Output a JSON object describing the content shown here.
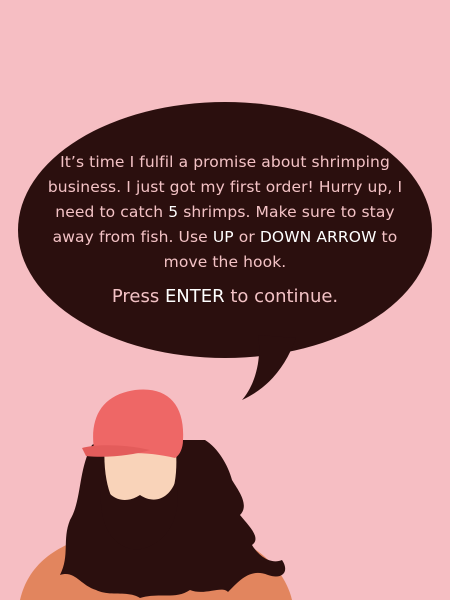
{
  "colors": {
    "background": "#f6bec3",
    "bubble": "#2b0f0e",
    "text": "#f3c2c5",
    "highlight": "#ffffff",
    "cap": "#ee6766",
    "skin": "#f9d3b9",
    "hair": "#2b0f0e",
    "shirt": "#e2855e"
  },
  "dialogue": {
    "part1": "It’s time I fulfil a promise about shrimping business. I just got my first order! Hurry up, I need to catch ",
    "count": "5",
    "part2": " shrimps. Make sure to stay away from fish. Use ",
    "key_up": "UP",
    "part3": " or ",
    "key_down": "DOWN ARROW",
    "part4": " to move the hook."
  },
  "prompt": {
    "before": "Press ",
    "key": "ENTER",
    "after": " to continue."
  },
  "character": {
    "icon": "bearded-man-with-cap-icon"
  }
}
